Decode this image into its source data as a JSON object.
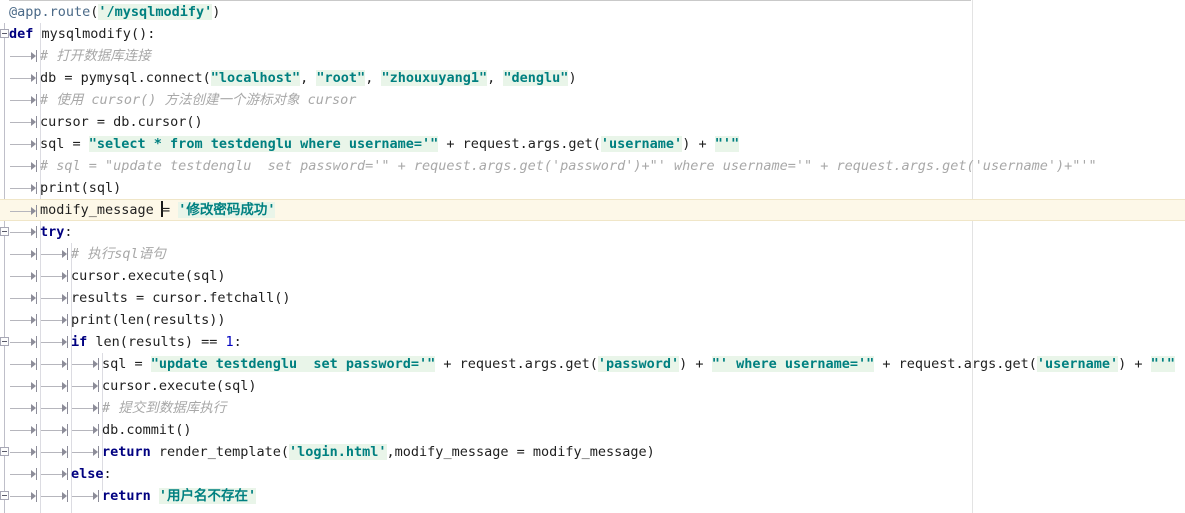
{
  "editor": {
    "language": "Python",
    "caret_line": 9,
    "colors": {
      "background": "#ffffff",
      "current_line_bg": "#fdf8e8",
      "string_fg": "#008080",
      "string_bg": "#e9f5e9",
      "keyword_fg": "#000080",
      "comment_fg": "#a8a8a8",
      "decorator_fg": "#4b6a88",
      "indent_guide": "#dcdce2",
      "tab_marker": "#8d8d99",
      "margin_guide": "#e3e3e3"
    },
    "margin_guide_x": 972
  },
  "code": {
    "lines": [
      {
        "n": 1,
        "indent": 0,
        "fold": "none",
        "current": false,
        "text": "@app.route('/mysqlmodify')"
      },
      {
        "n": 2,
        "indent": 0,
        "fold": "open",
        "current": false,
        "text": "def mysqlmodify():"
      },
      {
        "n": 3,
        "indent": 1,
        "fold": "none",
        "current": false,
        "text": "# 打开数据库连接"
      },
      {
        "n": 4,
        "indent": 1,
        "fold": "none",
        "current": false,
        "text": "db = pymysql.connect(\"localhost\", \"root\", \"zhouxuyang1\", \"denglu\")"
      },
      {
        "n": 5,
        "indent": 1,
        "fold": "none",
        "current": false,
        "text": "# 使用 cursor() 方法创建一个游标对象 cursor"
      },
      {
        "n": 6,
        "indent": 1,
        "fold": "none",
        "current": false,
        "text": "cursor = db.cursor()"
      },
      {
        "n": 7,
        "indent": 1,
        "fold": "none",
        "current": false,
        "text": "sql = \"select * from testdenglu where username='\" + request.args.get('username') + \"'\""
      },
      {
        "n": 8,
        "indent": 1,
        "fold": "none",
        "current": false,
        "text": "# sql = \"update testdenglu  set password='\" + request.args.get('password')+\"' where username='\" + request.args.get('username')+\"'\""
      },
      {
        "n": 9,
        "indent": 1,
        "fold": "none",
        "current": false,
        "text": "print(sql)"
      },
      {
        "n": 10,
        "indent": 1,
        "fold": "none",
        "current": true,
        "text": "modify_message = '修改密码成功'"
      },
      {
        "n": 11,
        "indent": 1,
        "fold": "open",
        "current": false,
        "text": "try:"
      },
      {
        "n": 12,
        "indent": 2,
        "fold": "none",
        "current": false,
        "text": "# 执行sql语句"
      },
      {
        "n": 13,
        "indent": 2,
        "fold": "none",
        "current": false,
        "text": "cursor.execute(sql)"
      },
      {
        "n": 14,
        "indent": 2,
        "fold": "none",
        "current": false,
        "text": "results = cursor.fetchall()"
      },
      {
        "n": 15,
        "indent": 2,
        "fold": "none",
        "current": false,
        "text": "print(len(results))"
      },
      {
        "n": 16,
        "indent": 2,
        "fold": "open",
        "current": false,
        "text": "if len(results) == 1:"
      },
      {
        "n": 17,
        "indent": 3,
        "fold": "none",
        "current": false,
        "text": "sql = \"update testdenglu  set password='\" + request.args.get('password') + \"' where username='\" + request.args.get('username') + \"'\""
      },
      {
        "n": 18,
        "indent": 3,
        "fold": "none",
        "current": false,
        "text": "cursor.execute(sql)"
      },
      {
        "n": 19,
        "indent": 3,
        "fold": "none",
        "current": false,
        "text": "# 提交到数据库执行"
      },
      {
        "n": 20,
        "indent": 3,
        "fold": "none",
        "current": false,
        "text": "db.commit()"
      },
      {
        "n": 21,
        "indent": 3,
        "fold": "open",
        "current": false,
        "text": "return render_template('login.html',modify_message = modify_message)"
      },
      {
        "n": 22,
        "indent": 2,
        "fold": "none",
        "current": false,
        "text": "else:"
      },
      {
        "n": 23,
        "indent": 3,
        "fold": "open",
        "current": false,
        "text": "return '用户名不存在'"
      }
    ]
  },
  "tokens": {
    "keywords": [
      "def",
      "try",
      "if",
      "else",
      "return"
    ],
    "sql_keywords": [
      "select",
      "from",
      "where",
      "update",
      "set"
    ],
    "strings": [
      "'/mysqlmodify'",
      "\"localhost\"",
      "\"root\"",
      "\"zhouxuyang1\"",
      "\"denglu\"",
      "'username'",
      "'password'",
      "'修改密码成功'",
      "'login.html'",
      "'用户名不存在'"
    ],
    "comments": [
      "# 打开数据库连接",
      "# 使用 cursor() 方法创建一个游标对象 cursor",
      "# sql = \"update testdenglu  set password='\" + request.args.get('password')+\"' where username='\" + request.args.get('username')+\"'\"",
      "# 执行sql语句",
      "# 提交到数据库执行"
    ]
  }
}
